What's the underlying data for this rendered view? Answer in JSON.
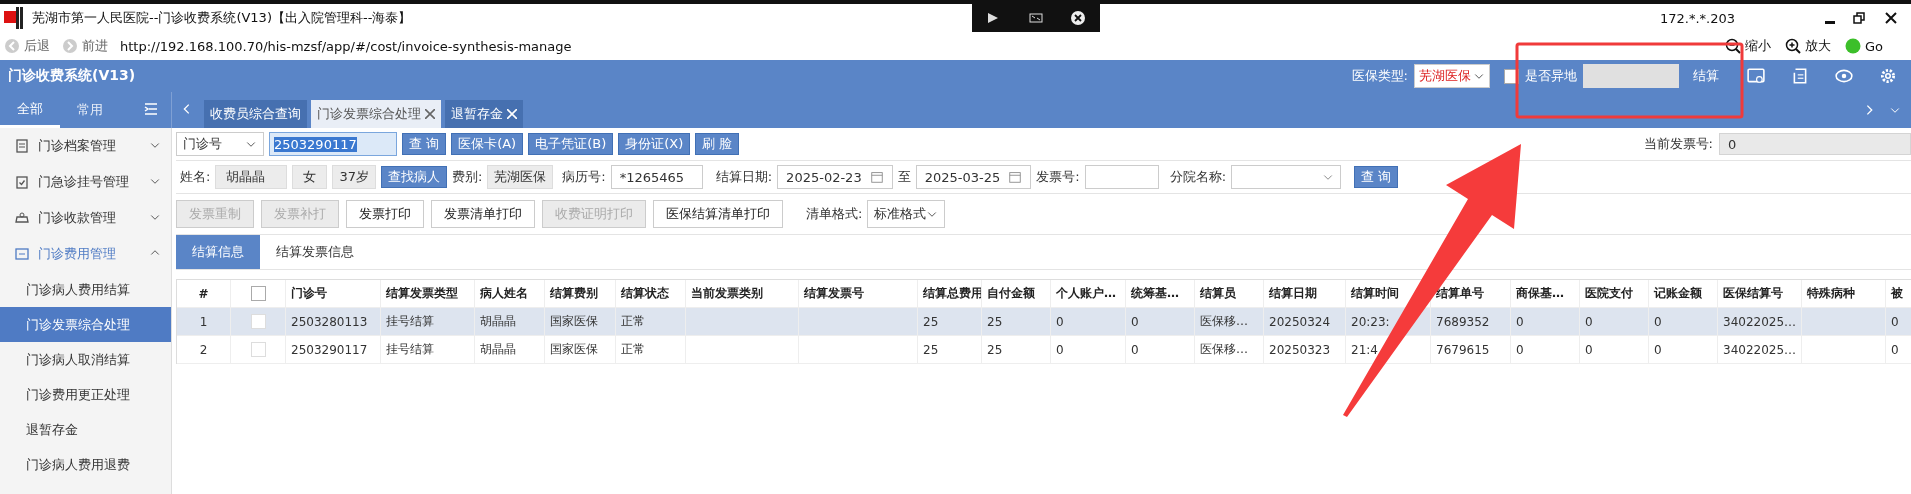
{
  "title_bar": {
    "title": "芜湖市第一人民医院--门诊收费系统(V13)【出入院管理科--海泰】",
    "host": "172.*.*.203"
  },
  "address_bar": {
    "back": "后退",
    "forward": "前进",
    "url": "http://192.168.100.70/his-mzsf/app/#/cost/invoice-synthesis-manage",
    "zoom_out": "缩小",
    "zoom_in": "放大",
    "go": "Go"
  },
  "header": {
    "app_title": "门诊收费系统(V13)",
    "insurance_label": "医保类型:",
    "insurance_value": "芜湖医保",
    "remote_label": "是否异地",
    "remote_checked": false,
    "settle": "结算"
  },
  "sidebar": {
    "tabs": [
      {
        "label": "全部",
        "selected": true
      },
      {
        "label": "常用",
        "selected": false
      }
    ],
    "items": [
      {
        "label": "门诊档案管理",
        "expanded": false
      },
      {
        "label": "门急诊挂号管理",
        "expanded": false
      },
      {
        "label": "门诊收款管理",
        "expanded": false
      },
      {
        "label": "门诊费用管理",
        "expanded": true,
        "children": [
          {
            "label": "门诊病人费用结算",
            "selected": false
          },
          {
            "label": "门诊发票综合处理",
            "selected": true
          },
          {
            "label": "门诊病人取消结算",
            "selected": false
          },
          {
            "label": "门诊费用更正处理",
            "selected": false
          },
          {
            "label": "退暂存金",
            "selected": false
          },
          {
            "label": "门诊病人费用退费",
            "selected": false
          }
        ]
      }
    ]
  },
  "tabs": [
    {
      "label": "收费员综合查询",
      "selected": false,
      "closable": false
    },
    {
      "label": "门诊发票综合处理",
      "selected": true,
      "closable": true
    },
    {
      "label": "退暂存金",
      "selected": false,
      "closable": true
    }
  ],
  "query": {
    "mode": "门诊号",
    "value": "2503290117",
    "buttons": [
      "查 询",
      "医保卡(A)",
      "电子凭证(B)",
      "身份证(X)",
      "刷 脸"
    ],
    "current_invoice_label": "当前发票号:",
    "current_invoice_value": "0"
  },
  "patient_row": {
    "name_label": "姓名:",
    "name": "胡晶晶",
    "sex": "女",
    "age": "37岁",
    "find_button": "查找病人",
    "fee_label": "费别:",
    "fee_type": "芜湖医保",
    "record_label": "病历号:",
    "record_no": "*1265465",
    "date_label": "结算日期:",
    "date_from": "2025-02-23",
    "date_sep": "至",
    "date_to": "2025-03-25",
    "invoice_label": "发票号:",
    "branch_label": "分院名称:",
    "search_button": "查 询"
  },
  "actions": [
    {
      "label": "发票重制",
      "disabled": true
    },
    {
      "label": "发票补打",
      "disabled": true
    },
    {
      "label": "发票打印",
      "disabled": false
    },
    {
      "label": "发票清单打印",
      "disabled": false
    },
    {
      "label": "收费证明打印",
      "disabled": true
    },
    {
      "label": "医保结算清单打印",
      "disabled": false
    }
  ],
  "format": {
    "label": "清单格式:",
    "value": "标准格式"
  },
  "sub_tabs": [
    {
      "label": "结算信息",
      "selected": true
    },
    {
      "label": "结算发票信息",
      "selected": false
    }
  ],
  "table": {
    "select_all_checked": false,
    "columns": [
      "#",
      "门诊号",
      "结算发票类型",
      "病人姓名",
      "结算费别",
      "结算状态",
      "当前发票类别",
      "结算发票号",
      "结算总费用",
      "自付金额",
      "个人账户…",
      "统筹基…",
      "结算员",
      "结算日期",
      "结算时间",
      "结算单号",
      "商保基…",
      "医院支付",
      "记账金额",
      "医保结算号",
      "特殊病种",
      "被"
    ],
    "rows": [
      {
        "selected": true,
        "checked": false,
        "cells": [
          "1",
          "2503280113",
          "挂号结算",
          "胡晶晶",
          "国家医保",
          "正常",
          null,
          null,
          "25",
          "25",
          "0",
          "0",
          "医保移…",
          "20250324",
          "20:23:",
          "7689352",
          "0",
          "0",
          "0",
          "34022025…",
          null,
          "0"
        ]
      },
      {
        "selected": false,
        "checked": false,
        "cells": [
          "2",
          "2503290117",
          "挂号结算",
          "胡晶晶",
          "国家医保",
          "正常",
          null,
          null,
          "25",
          "25",
          "0",
          "0",
          "医保移…",
          "20250323",
          "21:4",
          "7679615",
          "0",
          "0",
          "0",
          "34022025…",
          null,
          "0"
        ]
      }
    ]
  }
}
